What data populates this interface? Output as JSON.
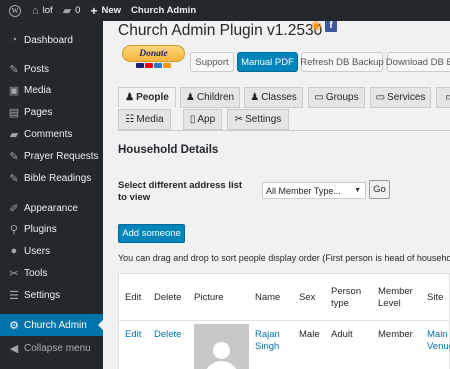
{
  "admin_bar": {
    "site_name": "lof",
    "comments_count": "0",
    "new_label": "New",
    "plugin_link": "Church Admin"
  },
  "sidebar": {
    "items": [
      {
        "label": "Dashboard",
        "icon": "dashboard-icon"
      },
      {
        "label": "Posts",
        "icon": "pin-icon"
      },
      {
        "label": "Media",
        "icon": "media-icon"
      },
      {
        "label": "Pages",
        "icon": "pages-icon"
      },
      {
        "label": "Comments",
        "icon": "comments-icon"
      },
      {
        "label": "Prayer Requests",
        "icon": "pin-icon"
      },
      {
        "label": "Bible Readings",
        "icon": "pin-icon"
      },
      {
        "label": "Appearance",
        "icon": "brush-icon"
      },
      {
        "label": "Plugins",
        "icon": "plugin-icon"
      },
      {
        "label": "Users",
        "icon": "user-icon"
      },
      {
        "label": "Tools",
        "icon": "wrench-icon"
      },
      {
        "label": "Settings",
        "icon": "settings-icon"
      },
      {
        "label": "Church Admin",
        "icon": "gear-icon"
      },
      {
        "label": "Collapse menu",
        "icon": "collapse-icon"
      }
    ],
    "active": "Church Admin"
  },
  "header": {
    "title": "Church Admin Plugin v1.2530"
  },
  "donate_label": "Donate",
  "buttons": {
    "support": "Support",
    "manual_pdf": "Manual PDF",
    "refresh_backup": "Refresh DB Backup",
    "download_backup": "Download DB Backup"
  },
  "tabs": [
    {
      "label": "People",
      "active": true
    },
    {
      "label": "Children",
      "active": false
    },
    {
      "label": "Classes",
      "active": false
    },
    {
      "label": "Groups",
      "active": false
    },
    {
      "label": "Services",
      "active": false
    },
    {
      "label": "Media",
      "active": false
    },
    {
      "label": "App",
      "active": false
    },
    {
      "label": "Settings",
      "active": false
    }
  ],
  "section_title": "Household Details",
  "address_form": {
    "label": "Select different address list to view",
    "selected": "All Member Type...",
    "go_label": "Go"
  },
  "add_someone_label": "Add someone",
  "drag_note": "You can drag and drop to sort people display order (First person is head of household)",
  "table": {
    "headers": [
      "Edit",
      "Delete",
      "Picture",
      "Name",
      "Sex",
      "Person type",
      "Member Level",
      "Site"
    ],
    "rows": [
      {
        "edit": "Edit",
        "delete": "Delete",
        "name": "Rajan Singh",
        "sex": "Male",
        "person_type": "Adult",
        "member_level": "Member",
        "site": "Main Venue"
      }
    ]
  },
  "colors": {
    "admin_dark": "#23282d",
    "primary_blue": "#0085ba",
    "link_blue": "#0073aa",
    "background": "#f1f1f1"
  }
}
